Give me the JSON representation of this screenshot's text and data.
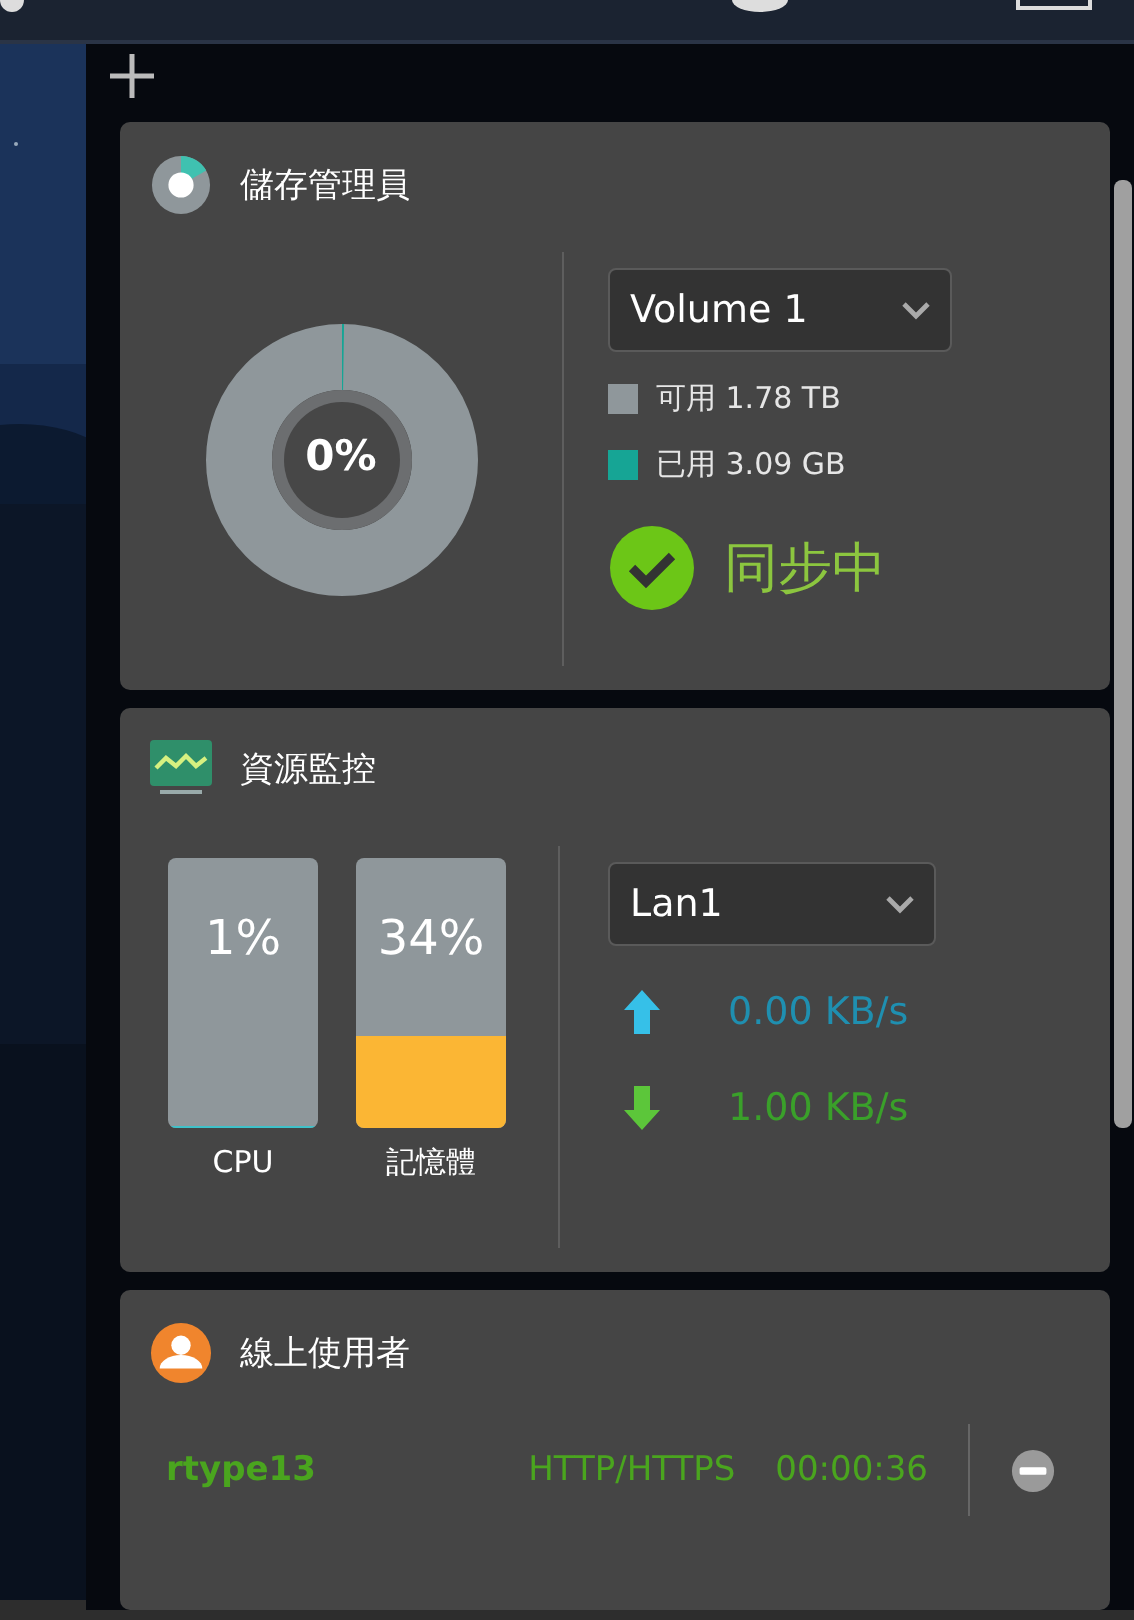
{
  "storage": {
    "title": "儲存管理員",
    "donut": {
      "level": 0.002,
      "label": "0%"
    },
    "volume": {
      "value": "Volume 1"
    },
    "legend": [
      {
        "label": "可用 1.78 TB",
        "color": "#8f979b"
      },
      {
        "label": "已用 3.09 GB",
        "color": "#16a595"
      }
    ],
    "status": {
      "label": "同步中",
      "ok": true
    }
  },
  "resources": {
    "title": "資源監控",
    "meters": [
      {
        "name": "CPU",
        "reading": "1%",
        "level": 0.01,
        "color": "#3fc1c9"
      },
      {
        "name": "記憶體",
        "reading": "34%",
        "level": 0.34,
        "color": "#fbb634"
      }
    ],
    "network": {
      "value": "Lan1"
    },
    "rates": [
      {
        "kind": "up",
        "reading": "0.00 KB/s",
        "color": "#1f8fb0"
      },
      {
        "kind": "down",
        "reading": "1.00 KB/s",
        "color": "#3aa02a"
      }
    ]
  },
  "online_users": {
    "title": "線上使用者",
    "users": [
      {
        "name": "rtype13",
        "protocol": "HTTP/HTTPS",
        "time": "00:00:36"
      }
    ]
  }
}
